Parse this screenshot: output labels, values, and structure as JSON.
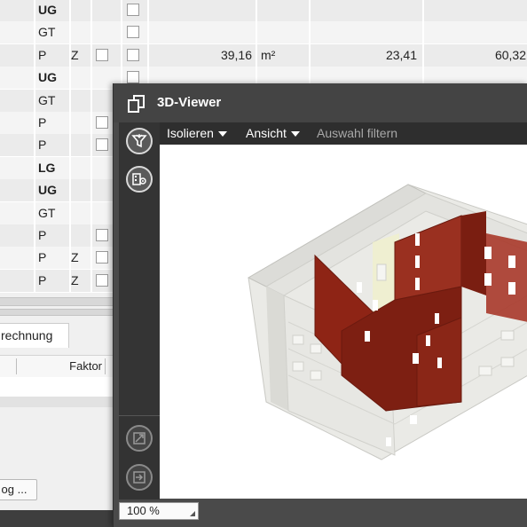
{
  "table": {
    "rows": [
      {
        "code": "UG",
        "bold": true,
        "z": "",
        "box1": false,
        "box2": true,
        "val1": "",
        "unit": "",
        "val2": "",
        "val3": ""
      },
      {
        "code": "GT",
        "bold": false,
        "z": "",
        "box1": false,
        "box2": true,
        "val1": "",
        "unit": "",
        "val2": "",
        "val3": ""
      },
      {
        "code": "P",
        "bold": false,
        "z": "Z",
        "box1": true,
        "box2": true,
        "val1": "39,16",
        "unit": "m²",
        "val2": "23,41",
        "val3": "60,32"
      },
      {
        "code": "UG",
        "bold": true,
        "z": "",
        "box1": false,
        "box2": true,
        "val1": "",
        "unit": "",
        "val2": "",
        "val3": ""
      },
      {
        "code": "GT",
        "bold": false,
        "z": "",
        "box1": false,
        "box2": false,
        "val1": "",
        "unit": "",
        "val2": "",
        "val3": ""
      },
      {
        "code": "P",
        "bold": false,
        "z": "",
        "box1": true,
        "box2": false,
        "val1": "",
        "unit": "",
        "val2": "",
        "val3": ""
      },
      {
        "code": "P",
        "bold": false,
        "z": "",
        "box1": true,
        "box2": false,
        "val1": "",
        "unit": "",
        "val2": "",
        "val3": ""
      },
      {
        "code": "LG",
        "bold": true,
        "z": "",
        "box1": false,
        "box2": false,
        "val1": "",
        "unit": "",
        "val2": "",
        "val3": ""
      },
      {
        "code": "UG",
        "bold": true,
        "z": "",
        "box1": false,
        "box2": false,
        "val1": "",
        "unit": "",
        "val2": "",
        "val3": ""
      },
      {
        "code": "GT",
        "bold": false,
        "z": "",
        "box1": false,
        "box2": false,
        "val1": "",
        "unit": "",
        "val2": "",
        "val3": ""
      },
      {
        "code": "P",
        "bold": false,
        "z": "",
        "box1": true,
        "box2": false,
        "val1": "",
        "unit": "",
        "val2": "",
        "val3": ""
      },
      {
        "code": "P",
        "bold": false,
        "z": "Z",
        "box1": true,
        "box2": false,
        "val1": "",
        "unit": "",
        "val2": "",
        "val3": ""
      },
      {
        "code": "P",
        "bold": false,
        "z": "Z",
        "box1": true,
        "box2": false,
        "val1": "",
        "unit": "",
        "val2": "",
        "val3": ""
      }
    ]
  },
  "lower_panel": {
    "tab_label": "rechnung",
    "column_factor": "Faktor",
    "catalog_button": "og ..."
  },
  "viewer": {
    "title": "3D-Viewer",
    "toolbar": {
      "isolate": "Isolieren",
      "view": "Ansicht",
      "filter": "Auswahl filtern"
    },
    "zoom": "100 %",
    "icons": {
      "filter": "funnel-filter-icon",
      "settings": "building-gear-icon",
      "zoom_extents": "zoom-extents-icon",
      "export": "export-icon"
    },
    "colors": {
      "window_bg": "#4a4a4a",
      "toolbar_bg": "#2e2e2e",
      "wall_red": "#8e2415"
    }
  }
}
